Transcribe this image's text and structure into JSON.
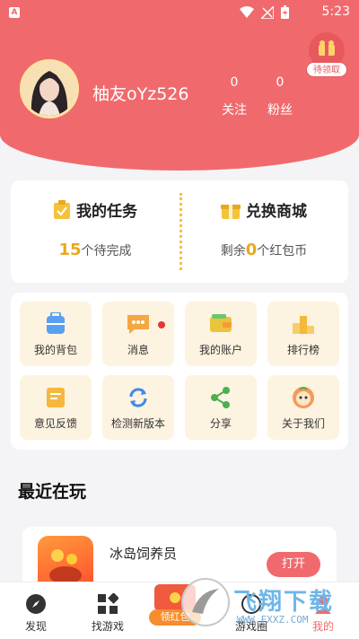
{
  "status": {
    "app_badge": "A",
    "time": "5:23"
  },
  "profile": {
    "username": "柚友oYz526",
    "following_count": "0",
    "following_label": "关注",
    "followers_count": "0",
    "followers_label": "粉丝",
    "gift_label": "待领取"
  },
  "tasks": {
    "left_title": "我的任务",
    "left_count": "15",
    "left_suffix": "个待完成",
    "right_title": "兑换商城",
    "right_prefix": "剩余",
    "right_count": "0",
    "right_suffix": "个红包币"
  },
  "grid_items": [
    {
      "label": "我的背包",
      "icon": "backpack-icon"
    },
    {
      "label": "消息",
      "icon": "message-icon"
    },
    {
      "label": "我的账户",
      "icon": "wallet-icon"
    },
    {
      "label": "排行榜",
      "icon": "ranking-icon"
    },
    {
      "label": "意见反馈",
      "icon": "feedback-icon"
    },
    {
      "label": "检测新版本",
      "icon": "refresh-icon"
    },
    {
      "label": "分享",
      "icon": "share-icon"
    },
    {
      "label": "关于我们",
      "icon": "about-icon"
    }
  ],
  "recent": {
    "title": "最近在玩",
    "game_name": "冰岛饲养员",
    "open_label": "打开"
  },
  "tabs": [
    {
      "label": "发现",
      "icon": "compass-icon"
    },
    {
      "label": "找游戏",
      "icon": "grid-icon"
    },
    {
      "label": "领红包",
      "icon": "red-envelope-icon"
    },
    {
      "label": "游戏圈",
      "icon": "circle-icon"
    },
    {
      "label": "我的",
      "icon": "profile-icon"
    }
  ],
  "watermark": {
    "text": "飞翔下载",
    "url_text": "WWW.FXXZ.COM"
  },
  "colors": {
    "header": "#f06a6d",
    "accent": "#e8a91b",
    "cell_bg": "#fdf3e1"
  }
}
